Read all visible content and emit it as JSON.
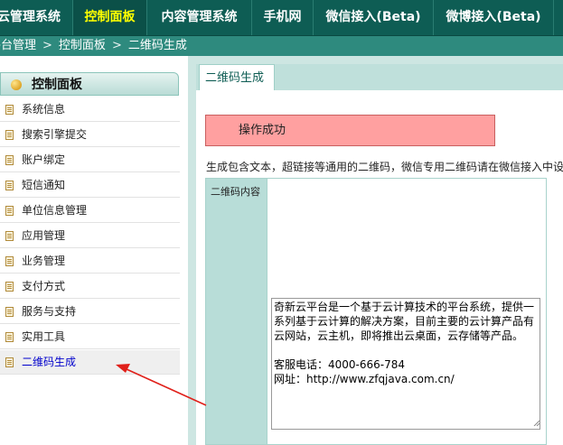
{
  "topnav": {
    "items": [
      {
        "label": "云管理系统",
        "active": false
      },
      {
        "label": "控制面板",
        "active": true
      },
      {
        "label": "内容管理系统",
        "active": false
      },
      {
        "label": "手机网",
        "active": false
      },
      {
        "label": "微信接入(Beta)",
        "active": false
      },
      {
        "label": "微博接入(Beta)",
        "active": false
      }
    ]
  },
  "breadcrumb": {
    "items": [
      "平台管理",
      "控制面板",
      "二维码生成"
    ],
    "separator": ">"
  },
  "sidebar": {
    "title": "控制面板",
    "items": [
      {
        "label": "系统信息"
      },
      {
        "label": "搜索引擎提交"
      },
      {
        "label": "账户绑定"
      },
      {
        "label": "短信通知"
      },
      {
        "label": "单位信息管理"
      },
      {
        "label": "应用管理"
      },
      {
        "label": "业务管理"
      },
      {
        "label": "支付方式"
      },
      {
        "label": "服务与支持"
      },
      {
        "label": "实用工具"
      },
      {
        "label": "二维码生成",
        "active": true
      }
    ]
  },
  "main": {
    "tab_label": "二维码生成",
    "alert_text": "操作成功",
    "description": "生成包含文本，超链接等通用的二维码，微信专用二维码请在微信接入中设置。",
    "form": {
      "content_label": "二维码内容",
      "content_value": "奇新云平台是一个基于云计算技术的平台系统，提供一系列基于云计算的解决方案，目前主要的云计算产品有云网站，云主机，即将推出云桌面，云存储等产品。\n\n客服电话：4000-666-784\n网址：http://www.zfqjava.com.cn/"
    }
  },
  "colors": {
    "nav_bg": "#0e5d54",
    "nav_active_text": "#ffff00",
    "breadcrumb_bg": "#2e8a7e",
    "panel_bg": "#cde6e2",
    "alert_bg": "#ffa0a0",
    "arrow": "#e0201a"
  },
  "icons": {
    "sidebar_head": "orb-icon",
    "sidebar_item": "document-icon",
    "annotation": "red-arrow"
  }
}
